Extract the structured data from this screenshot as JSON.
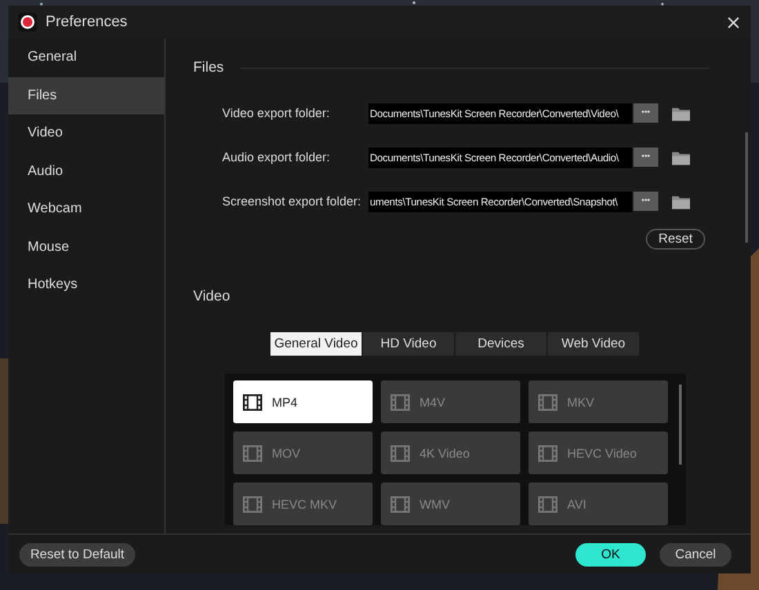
{
  "window": {
    "title": "Preferences"
  },
  "sidebar": {
    "items": [
      {
        "label": "General",
        "selected": false
      },
      {
        "label": "Files",
        "selected": true
      },
      {
        "label": "Video",
        "selected": false
      },
      {
        "label": "Audio",
        "selected": false
      },
      {
        "label": "Webcam",
        "selected": false
      },
      {
        "label": "Mouse",
        "selected": false
      },
      {
        "label": "Hotkeys",
        "selected": false
      }
    ]
  },
  "files": {
    "heading": "Files",
    "rows": [
      {
        "label": "Video export folder:",
        "value": "Documents\\TunesKit Screen Recorder\\Converted\\Video\\"
      },
      {
        "label": "Audio export folder:",
        "value": "Documents\\TunesKit Screen Recorder\\Converted\\Audio\\"
      },
      {
        "label": "Screenshot export folder:",
        "value": "uments\\TunesKit Screen Recorder\\Converted\\Snapshot\\"
      }
    ],
    "browse_button": "•••",
    "reset_button": "Reset"
  },
  "video": {
    "heading": "Video",
    "tabs": [
      {
        "label": "General Video",
        "selected": true
      },
      {
        "label": "HD Video",
        "selected": false
      },
      {
        "label": "Devices",
        "selected": false
      },
      {
        "label": "Web Video",
        "selected": false
      }
    ],
    "formats": [
      {
        "label": "MP4",
        "selected": true
      },
      {
        "label": "M4V",
        "selected": false
      },
      {
        "label": "MKV",
        "selected": false
      },
      {
        "label": "MOV",
        "selected": false
      },
      {
        "label": "4K Video",
        "selected": false
      },
      {
        "label": "HEVC Video",
        "selected": false
      },
      {
        "label": "HEVC MKV",
        "selected": false
      },
      {
        "label": "WMV",
        "selected": false
      },
      {
        "label": "AVI",
        "selected": false
      }
    ]
  },
  "footer": {
    "reset_default": "Reset to Default",
    "ok": "OK",
    "cancel": "Cancel"
  }
}
